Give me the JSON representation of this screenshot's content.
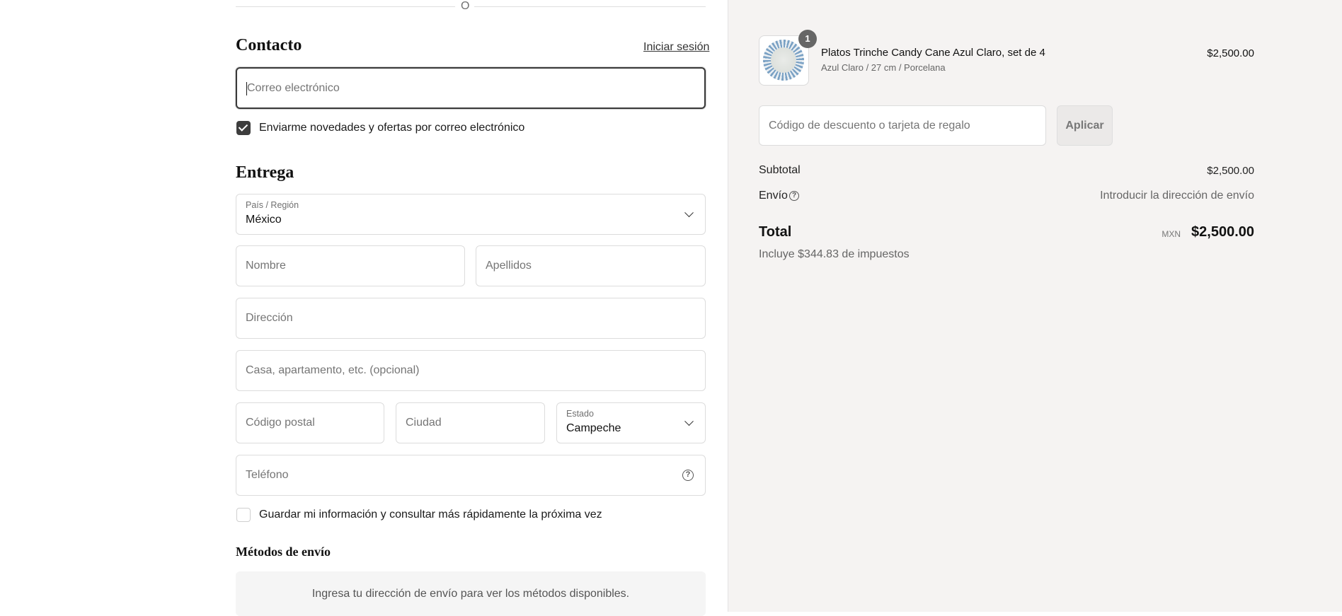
{
  "divider": {
    "text": "O"
  },
  "contact": {
    "title": "Contacto",
    "login_link": "Iniciar sesión",
    "email_placeholder": "Correo electrónico",
    "newsletter_label": "Enviarme novedades y ofertas por correo electrónico",
    "newsletter_checked": true
  },
  "delivery": {
    "title": "Entrega",
    "country_label": "País / Región",
    "country_value": "México",
    "first_name_placeholder": "Nombre",
    "last_name_placeholder": "Apellidos",
    "address_placeholder": "Dirección",
    "apartment_placeholder": "Casa, apartamento, etc. (opcional)",
    "postal_placeholder": "Código postal",
    "city_placeholder": "Ciudad",
    "state_label": "Estado",
    "state_value": "Campeche",
    "phone_placeholder": "Teléfono",
    "save_info_label": "Guardar mi información y consultar más rápidamente la próxima vez",
    "save_info_checked": false
  },
  "shipping_methods": {
    "title": "Métodos de envío",
    "empty_message": "Ingresa tu dirección de envío para ver los métodos disponibles."
  },
  "summary": {
    "product": {
      "quantity": "1",
      "name": "Platos Trinche Candy Cane Azul Claro, set de 4",
      "variant": "Azul Claro / 27 cm / Porcelana",
      "price": "$2,500.00"
    },
    "discount_placeholder": "Código de descuento o tarjeta de regalo",
    "apply_label": "Aplicar",
    "subtotal_label": "Subtotal",
    "subtotal_value": "$2,500.00",
    "shipping_label": "Envío",
    "shipping_value": "Introducir la dirección de envío",
    "total_label": "Total",
    "currency": "MXN",
    "total_value": "$2,500.00",
    "tax_note": "Incluye $344.83 de impuestos"
  },
  "colors": {
    "summary_background": "#f5f3f2",
    "checkbox_checked": "#3d3d3d",
    "quantity_badge": "#666666"
  }
}
